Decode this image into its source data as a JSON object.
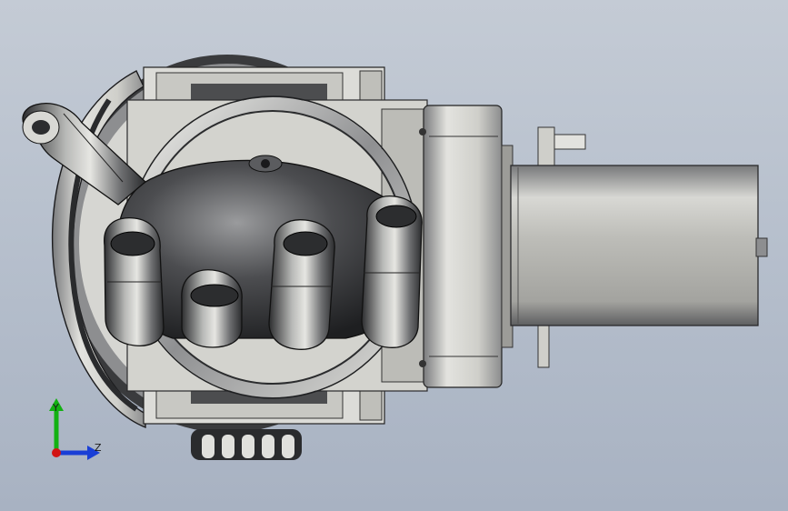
{
  "viewport": {
    "background_top": "#c4cbd5",
    "background_bottom": "#a8b2c2"
  },
  "model": {
    "description_icon": "robotic-hand-gripper-icon",
    "body_color": "#d9d8d2",
    "shadow_color": "#5a5b5e"
  },
  "triad": {
    "y_label": "Y",
    "z_label": "Z",
    "y_color": "#12b112",
    "z_color": "#1a3fd6",
    "x_color": "#d21414"
  }
}
